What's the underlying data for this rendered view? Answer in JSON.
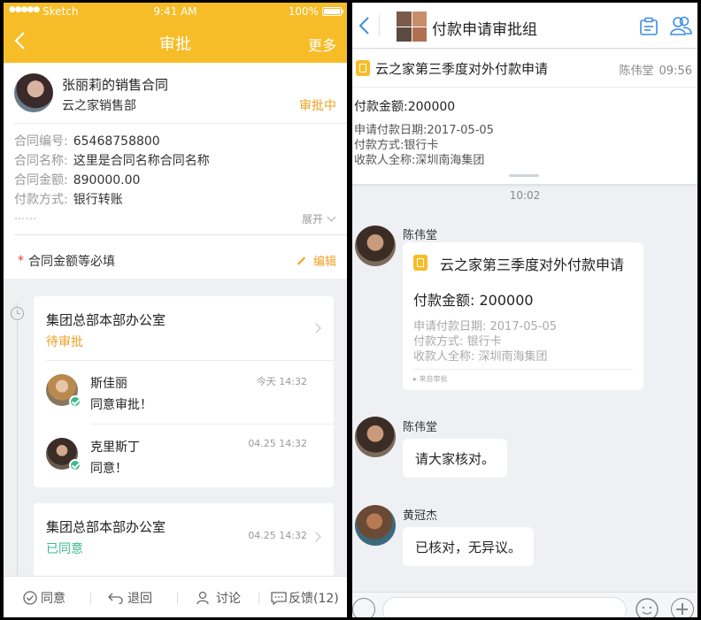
{
  "left": {
    "status_bar": {
      "signal": "●●●●●",
      "carrier": "Sketch",
      "time": "9:41 AM",
      "battery": "100%"
    },
    "nav": {
      "title": "审批",
      "more": "更多"
    },
    "applicant": {
      "name": "张丽莉的销售合同",
      "dept": "云之家销售部",
      "status": "审批中"
    },
    "fields": [
      {
        "label": "合同编号:",
        "value": "65468758800"
      },
      {
        "label": "合同名称:",
        "value": "这里是合同名称合同名称"
      },
      {
        "label": "合同金额:",
        "value": "890000.00"
      },
      {
        "label": "付款方式:",
        "value": "银行转账"
      }
    ],
    "ellipsis": "……",
    "expand": "展开",
    "required_star": "*",
    "required_text": "合同金额等必填",
    "edit": "编辑",
    "steps": [
      {
        "office": "集团总部本部办公室",
        "state": "待审批",
        "approvers": [
          {
            "name": "斯佳丽",
            "comment": "同意审批！",
            "time": "今天 14:32"
          },
          {
            "name": "克里斯丁",
            "comment": "同意！",
            "time": "04.25 14:32"
          }
        ]
      },
      {
        "office": "集团总部本部办公室",
        "state": "已同意",
        "time": "04.25 14:32"
      }
    ],
    "bottom_bar": {
      "agree": "同意",
      "return": "退回",
      "discuss": "讨论",
      "feedback": "反馈(12)"
    },
    "colors": {
      "brand": "#f6bd28",
      "pending": "#f0a020",
      "approved": "#3cba8c"
    }
  },
  "right": {
    "nav": {
      "title": "付款申请审批组"
    },
    "pinned": {
      "title": "云之家第三季度对外付款申请",
      "sender": "陈伟堂",
      "time": "09:56",
      "amount": "付款金额:200000",
      "lines": [
        "申请付款日期:2017-05-05",
        "付款方式:银行卡",
        "收款人全称:深圳南海集团"
      ]
    },
    "timestamp": "10:02",
    "messages": [
      {
        "sender": "陈伟堂",
        "card": {
          "title": "云之家第三季度对外付款申请",
          "amount": "付款金额: 200000",
          "lines": [
            "申请付款日期: 2017-05-05",
            "付款方式: 银行卡",
            "收款人全称: 深圳南海集团"
          ],
          "source": "▸ 来自审批"
        }
      },
      {
        "sender": "陈伟堂",
        "text": "请大家核对。"
      },
      {
        "sender": "黄冠杰",
        "text": "已核对，无异议。"
      }
    ],
    "colors": {
      "accent": "#3a8ee6"
    }
  }
}
